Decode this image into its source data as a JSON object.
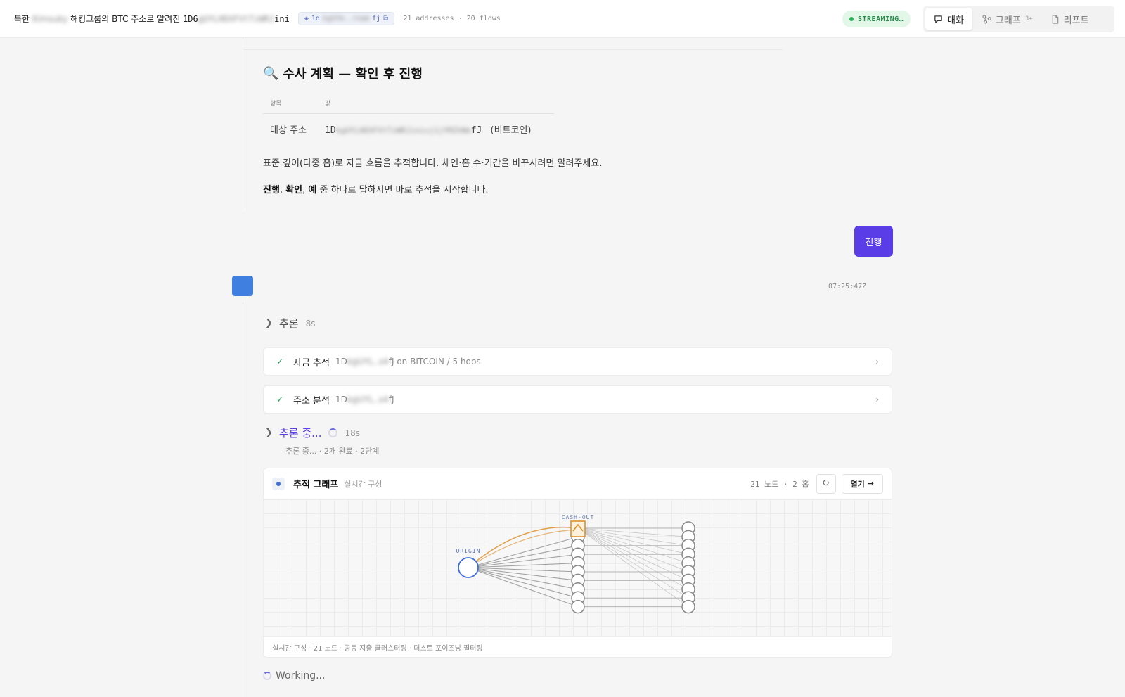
{
  "header": {
    "title_prefix": "북한",
    "title_group_blur": "Kimsuky",
    "title_middle": "해킹그룹의 BTC 주소로 알려진",
    "title_addr_start": "1D6",
    "title_addr_blur": "gUYLHDXFVtTzWRJ",
    "title_addr_end": "ini",
    "chip_start": "1d",
    "chip_blur": "kgUYm..ream",
    "chip_end": "fj",
    "meta": "21 addresses · 20 flows",
    "streaming": "STREAMING…"
  },
  "tabs": [
    {
      "label": "대화",
      "icon": "chat-icon",
      "active": true
    },
    {
      "label": "그래프",
      "icon": "graph-icon",
      "badge": "3+"
    },
    {
      "label": "리포트",
      "icon": "document-icon"
    }
  ],
  "plan": {
    "heading_icon": "🔍",
    "heading": "수사 계획 — 확인 후 진행",
    "col_item": "항목",
    "col_value": "값",
    "row_label": "대상 주소",
    "addr_start": "1D",
    "addr_blur": "kgUYLHDXFVtTzWRJinivj1jYMZhNm",
    "addr_end": "fJ",
    "addr_suffix": "(비트코인)",
    "para1": "표준 깊이(다중 홉)로 자금 흐름을 추적합니다. 체인·홉 수·기간을 바꾸시려면 알려주세요.",
    "para2_b1": "진행",
    "para2_sep1": ", ",
    "para2_b2": "확인",
    "para2_sep2": ", ",
    "para2_b3": "예",
    "para2_rest": " 중 하나로 답하시면 바로 추적을 시작합니다."
  },
  "user_message": "진행",
  "timestamp": "07:25:47Z",
  "reasoning1": {
    "label": "추론",
    "duration": "8s"
  },
  "tool_calls": [
    {
      "name": "자금 추적",
      "detail_start": "1D",
      "detail_blur": "kgUYL..s4",
      "detail_end": "fJ on BITCOIN / 5 hops"
    },
    {
      "name": "주소 분석",
      "detail_start": "1D",
      "detail_blur": "kgUYL..s4",
      "detail_end": "fJ"
    }
  ],
  "reasoning2": {
    "label": "추론 중...",
    "duration": "18s",
    "note": "추론 중... · 2개 완료 · 2단계"
  },
  "graph": {
    "title": "추적 그래프",
    "subtitle": "실시간 구성",
    "stats": "21 노드 · 2 홉",
    "open_label": "열기",
    "origin_label": "ORIGIN",
    "cashout_label": "CASH-OUT",
    "footer": "실시간 구성 · 21 노드 · 공동 지출 클러스터링 · 더스트 포이즈닝 필터링",
    "hop1_count": 10,
    "hop2_count": 10,
    "colors": {
      "origin": "#3f6fd8",
      "cashout": "#d98b1f",
      "node": "#888888",
      "edge": "#b5b5b5"
    }
  },
  "status": "Working..."
}
